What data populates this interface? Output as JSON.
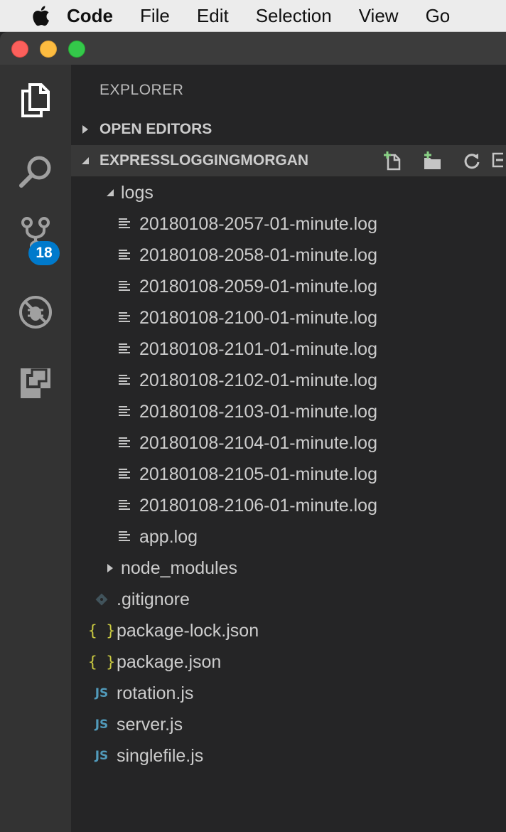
{
  "menubar": {
    "app_name": "Code",
    "items": [
      "File",
      "Edit",
      "Selection",
      "View",
      "Go"
    ]
  },
  "activitybar": {
    "icons": [
      "files-icon",
      "search-icon",
      "source-control-icon",
      "debug-icon",
      "extensions-icon"
    ],
    "scm_badge": "18"
  },
  "explorer": {
    "title": "EXPLORER",
    "open_editors": "OPEN EDITORS",
    "project": "EXPRESSLOGGINGMORGAN",
    "tree": {
      "logs_folder": "logs",
      "log_files": [
        "20180108-2057-01-minute.log",
        "20180108-2058-01-minute.log",
        "20180108-2059-01-minute.log",
        "20180108-2100-01-minute.log",
        "20180108-2101-01-minute.log",
        "20180108-2102-01-minute.log",
        "20180108-2103-01-minute.log",
        "20180108-2104-01-minute.log",
        "20180108-2105-01-minute.log",
        "20180108-2106-01-minute.log",
        "app.log"
      ],
      "node_modules": "node_modules",
      "root_files": [
        {
          "name": ".gitignore",
          "icon": "git-icon"
        },
        {
          "name": "package-lock.json",
          "icon": "json-icon"
        },
        {
          "name": "package.json",
          "icon": "json-icon"
        },
        {
          "name": "rotation.js",
          "icon": "js-icon"
        },
        {
          "name": "server.js",
          "icon": "js-icon"
        },
        {
          "name": "singlefile.js",
          "icon": "js-icon"
        }
      ]
    },
    "icon_glyphs": {
      "json": "{ }",
      "js": "JS"
    }
  },
  "colors": {
    "activitybar": "#333333",
    "sidebar": "#252526",
    "accent_badge": "#007acc",
    "js_icon": "#519aba",
    "json_icon": "#cbcb41"
  }
}
